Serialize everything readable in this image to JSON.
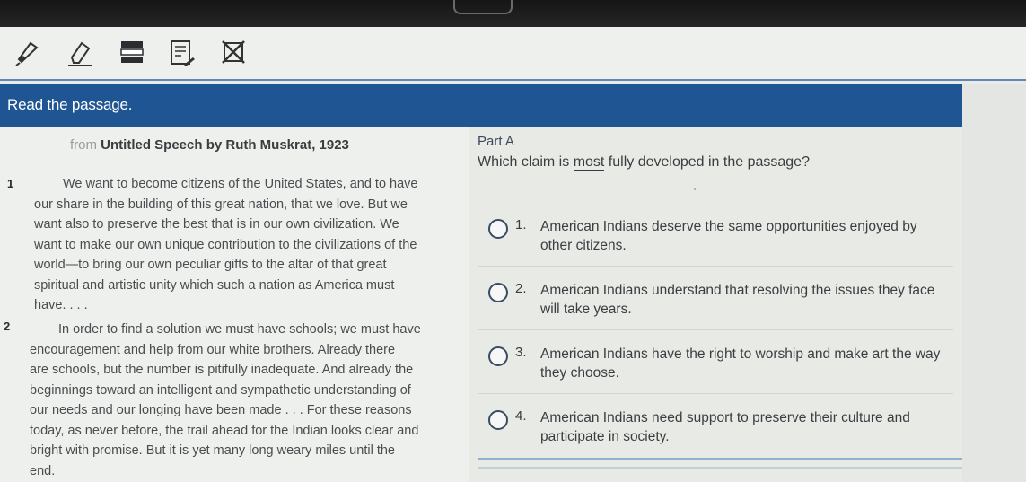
{
  "toolbar": {
    "tools": [
      {
        "icon": "highlighter-icon"
      },
      {
        "icon": "eraser-icon"
      },
      {
        "icon": "line-reader-icon"
      },
      {
        "icon": "notepad-icon"
      },
      {
        "icon": "answer-eliminator-icon"
      }
    ]
  },
  "banner": {
    "text": "Read the passage."
  },
  "passage": {
    "source_prefix": "from",
    "source_title": "Untitled Speech by Ruth Muskrat, 1923",
    "paragraphs": [
      {
        "number": "1",
        "lines": [
          "We want to become citizens of the United States, and to have",
          "our share in the building of this great nation, that we love. But we",
          "want also to preserve the best that is in our own civilization. We",
          "want to make our own unique contribution to the civilizations of the",
          "world—to bring our own peculiar gifts to the altar of that great",
          "spiritual and artistic unity which such a nation as America must",
          "have. . . ."
        ]
      },
      {
        "number": "2",
        "lines": [
          "In order to find a solution we must have schools; we must have",
          "encouragement and help from our white brothers. Already there",
          "are schools, but the number is pitifully inadequate. And already the",
          "beginnings toward an intelligent and sympathetic understanding of",
          "our needs and our longing have been made . . . For these reasons",
          "today, as never before, the trail ahead for the Indian looks clear and",
          "bright with promise. But it is yet many long weary miles until the",
          "end."
        ]
      }
    ]
  },
  "question": {
    "part": "Part A",
    "prompt_before": "Which claim is ",
    "prompt_emphasis": "most",
    "prompt_after": " fully developed in the passage?",
    "options": [
      {
        "number": "1.",
        "text": "American Indians deserve the same opportunities enjoyed by other citizens."
      },
      {
        "number": "2.",
        "text": "American Indians understand that resolving the issues they face will take years."
      },
      {
        "number": "3.",
        "text": "American Indians have the right to worship and make art the way they choose."
      },
      {
        "number": "4.",
        "text": "American Indians need support to preserve their culture and participate in society."
      }
    ]
  },
  "colors": {
    "banner": "#1f5592",
    "toolbar_rule": "#5e88b3",
    "radio_border": "#3a4c63"
  }
}
